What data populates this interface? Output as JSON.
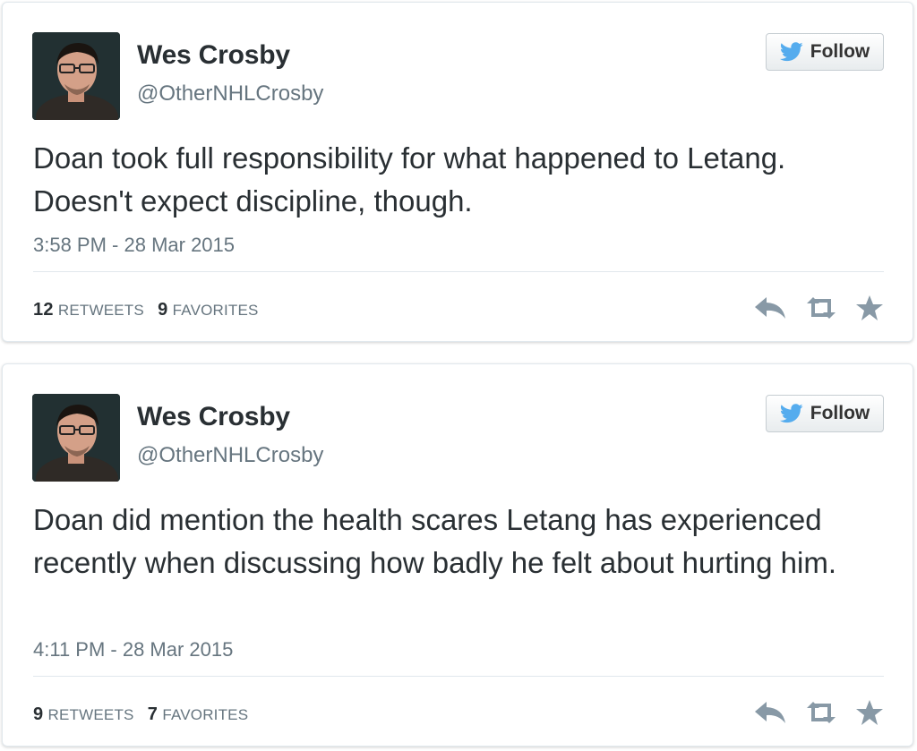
{
  "colors": {
    "name": "#292f33",
    "secondary": "#66757f",
    "divider": "#e1e8ed",
    "twitter_blue": "#55acee",
    "action_icons": "#8899a6"
  },
  "tweets": [
    {
      "user": {
        "name": "Wes Crosby",
        "handle": "@OtherNHLCrosby"
      },
      "follow_label": "Follow",
      "text": "Doan took full responsibility for what happened to Letang. Doesn't expect discipline, though.",
      "timestamp": "3:58 PM - 28 Mar 2015",
      "retweets": "12",
      "retweets_label": "RETWEETS",
      "favorites": "9",
      "favorites_label": "FAVORITES",
      "icons": [
        "reply-icon",
        "retweet-icon",
        "favorite-icon"
      ]
    },
    {
      "user": {
        "name": "Wes Crosby",
        "handle": "@OtherNHLCrosby"
      },
      "follow_label": "Follow",
      "text": "Doan did mention the health scares Letang has experienced recently when discussing how badly he felt about hurting him.",
      "timestamp": "4:11 PM - 28 Mar 2015",
      "retweets": "9",
      "retweets_label": "RETWEETS",
      "favorites": "7",
      "favorites_label": "FAVORITES",
      "icons": [
        "reply-icon",
        "retweet-icon",
        "favorite-icon"
      ]
    }
  ]
}
